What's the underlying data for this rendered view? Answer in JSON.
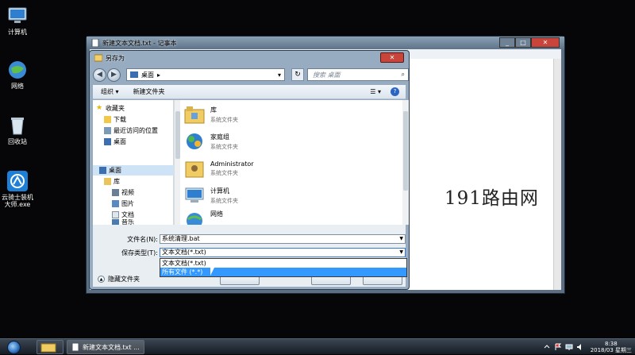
{
  "desktop": {
    "icons": [
      {
        "label": "计算机",
        "icon": "computer-icon"
      },
      {
        "label": "网络",
        "icon": "network-icon"
      },
      {
        "label": "回收站",
        "icon": "recycle-bin-icon"
      },
      {
        "label_line1": "云骑士装机",
        "label_line2": "大师.exe",
        "icon": "app-installer-icon"
      }
    ]
  },
  "notepad": {
    "title": "新建文本文档.txt - 记事本",
    "minimize": "_",
    "maximize": "□",
    "close": "✕"
  },
  "saveas": {
    "title": "另存为",
    "close": "✕",
    "back": "◀",
    "forward": "▶",
    "address": {
      "location": "桌面",
      "separator": "▸",
      "dropdown": "▾"
    },
    "refresh": "↻",
    "search_placeholder": "搜索 桌面",
    "search_icon": "⌕",
    "toolbar": {
      "organize": "组织 ▾",
      "new_folder": "新建文件夹",
      "view": "☰ ▾",
      "help": "?"
    },
    "nav": {
      "favorites": "收藏夹",
      "downloads": "下载",
      "recent": "最近访问的位置",
      "desktop_fav": "桌面",
      "desktop": "桌面",
      "library": "库",
      "videos": "视频",
      "pictures": "图片",
      "documents": "文档",
      "music": "音乐"
    },
    "files": [
      {
        "name": "库",
        "type": "系统文件夹",
        "icon": "library-icon"
      },
      {
        "name": "家庭组",
        "type": "系统文件夹",
        "icon": "homegroup-icon"
      },
      {
        "name": "Administrator",
        "type": "系统文件夹",
        "icon": "user-folder-icon"
      },
      {
        "name": "计算机",
        "type": "系统文件夹",
        "icon": "computer-icon"
      },
      {
        "name": "网络",
        "type": "",
        "icon": "network-icon"
      }
    ],
    "form": {
      "filename_label": "文件名(N):",
      "filename_value": "系统清理.bat",
      "filetype_label": "保存类型(T):",
      "filetype_value": "文本文档(*.txt)",
      "options": [
        "文本文档(*.txt)",
        "所有文件 (*.*)"
      ],
      "hide_folders": "隐藏文件夹"
    }
  },
  "watermark": "191路由网",
  "taskbar": {
    "app_label": "新建文本文档.txt ...",
    "clock_time": "8:38",
    "clock_date": "2018/03 星期三"
  }
}
